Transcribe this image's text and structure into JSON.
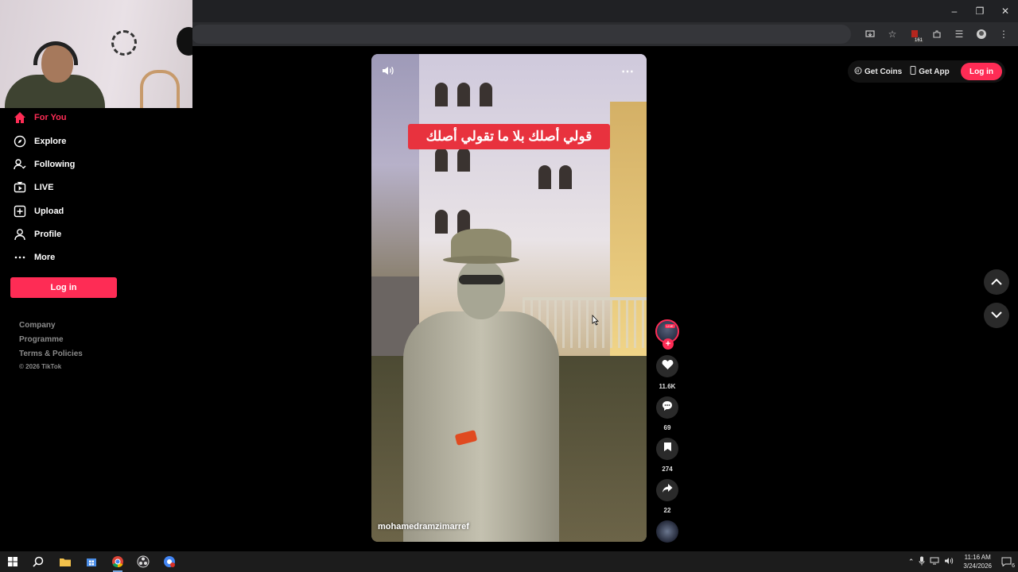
{
  "browser": {
    "extension_badge": "161"
  },
  "sidebar": {
    "items": [
      {
        "label": "For You",
        "icon": "home-icon"
      },
      {
        "label": "Explore",
        "icon": "compass-icon"
      },
      {
        "label": "Following",
        "icon": "following-icon"
      },
      {
        "label": "LIVE",
        "icon": "live-tv-icon"
      },
      {
        "label": "Upload",
        "icon": "upload-icon"
      },
      {
        "label": "Profile",
        "icon": "profile-icon"
      },
      {
        "label": "More",
        "icon": "more-dots-icon"
      }
    ],
    "login_label": "Log in",
    "footer": [
      "Company",
      "Programme",
      "Terms & Policies"
    ],
    "copyright": "© 2026 TikTok"
  },
  "header": {
    "get_coins": "Get Coins",
    "get_app": "Get App",
    "login": "Log in"
  },
  "video": {
    "caption_overlay": "قولي أصلك بلا ما تقولي أصلك",
    "author": "mohamedramzimarref"
  },
  "actions": {
    "live_tag": "LIVE",
    "likes": "11.6K",
    "comments": "69",
    "saves": "274",
    "shares": "22"
  },
  "taskbar": {
    "time": "11:16 AM",
    "date": "3/24/2026",
    "notification_count": "6"
  },
  "colors": {
    "accent": "#fe2c55",
    "background": "#000000",
    "caption_bg": "#e8323e"
  }
}
